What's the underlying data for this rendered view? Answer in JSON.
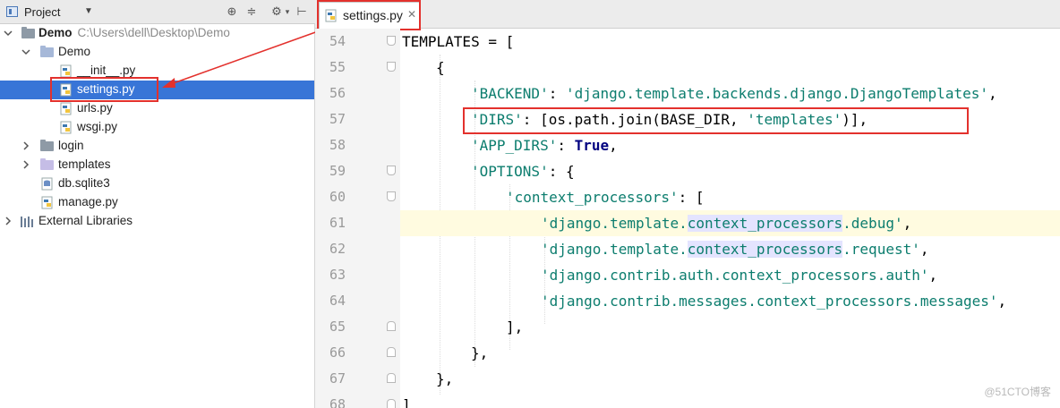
{
  "project_panel": {
    "title": "Project",
    "tree": [
      {
        "label": "Demo",
        "hint": "C:\\Users\\dell\\Desktop\\Demo"
      },
      {
        "label": "Demo"
      },
      {
        "label": "__init__.py"
      },
      {
        "label": "settings.py"
      },
      {
        "label": "urls.py"
      },
      {
        "label": "wsgi.py"
      },
      {
        "label": "login"
      },
      {
        "label": "templates"
      },
      {
        "label": "db.sqlite3"
      },
      {
        "label": "manage.py"
      },
      {
        "label": "External Libraries"
      }
    ]
  },
  "editor": {
    "tab_label": "settings.py",
    "line_numbers": [
      "54",
      "55",
      "56",
      "57",
      "58",
      "59",
      "60",
      "61",
      "62",
      "63",
      "64",
      "65",
      "66",
      "67",
      "68"
    ],
    "lines": {
      "l54": {
        "a": "TEMPLATES = ["
      },
      "l55": {
        "a": "{"
      },
      "l56": {
        "s": "'BACKEND'",
        "p": ": ",
        "v": "'django.template.backends.django.DjangoTemplates'",
        "e": ","
      },
      "l57": {
        "s": "'DIRS'",
        "p": ": [os.path.join(BASE_DIR, ",
        "v": "'templates'",
        "e": ")],"
      },
      "l58": {
        "s": "'APP_DIRS'",
        "p": ": ",
        "k": "True",
        "e": ","
      },
      "l59": {
        "s": "'OPTIONS'",
        "p": ": {"
      },
      "l60": {
        "s": "'context_processors'",
        "p": ": ["
      },
      "l61": {
        "a": "'django.template.",
        "m": "context_processors",
        "b": ".debug'",
        "e": ","
      },
      "l62": {
        "a": "'django.template.",
        "m": "context_processors",
        "b": ".request'",
        "e": ","
      },
      "l63": {
        "v": "'django.contrib.auth.context_processors.auth'",
        "e": ","
      },
      "l64": {
        "v": "'django.contrib.messages.context_processors.messages'",
        "e": ","
      },
      "l65": {
        "a": "],"
      },
      "l66": {
        "a": "},"
      },
      "l67": {
        "a": "},"
      },
      "l68": {
        "a": "]"
      }
    }
  },
  "watermark": "@51CTO博客",
  "colors": {
    "selection": "#3875d7",
    "annotation": "#e3312d",
    "string": "#0c7d6e",
    "keyword": "#000080",
    "caret_line": "#fffbe0"
  }
}
